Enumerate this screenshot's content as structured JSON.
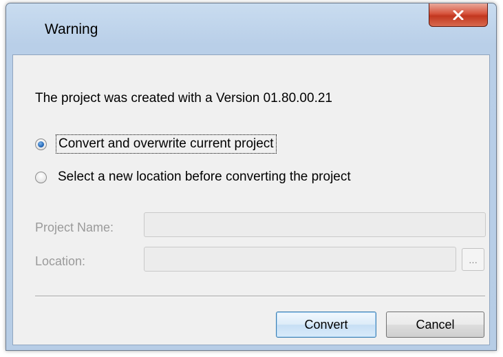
{
  "window": {
    "title": "Warning"
  },
  "dialog": {
    "message": "The project was created with a Version 01.80.00.21",
    "options": [
      {
        "label": "Convert and overwrite current project",
        "selected": true
      },
      {
        "label": "Select a new location before converting the project",
        "selected": false
      }
    ],
    "project_name": {
      "label": "Project Name:",
      "value": ""
    },
    "location": {
      "label": "Location:",
      "value": "",
      "browse_label": "..."
    },
    "buttons": {
      "convert_label": "Convert",
      "cancel_label": "Cancel"
    }
  },
  "icons": {
    "close": "close-icon"
  },
  "colors": {
    "close_button": "#c2371f",
    "disabled_text": "#9a9a9a",
    "radio_selected": "#2468b8"
  }
}
